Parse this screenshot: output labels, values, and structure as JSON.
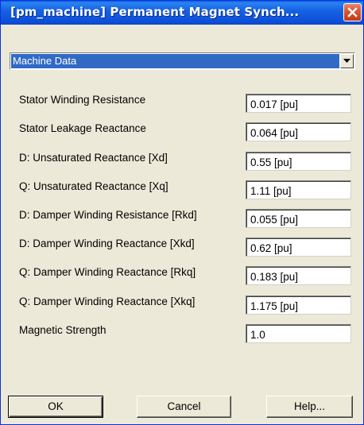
{
  "window": {
    "title": "[pm_machine] Permanent Magnet Synch..."
  },
  "icons": {
    "close": "close-icon",
    "dropdown_arrow": "chevron-down-icon"
  },
  "colors": {
    "titlebar": "#0d4fd8",
    "close_button": "#d9542f",
    "selection": "#316ac5",
    "dialog_background": "#ece9d8"
  },
  "category": {
    "selected": "Machine Data"
  },
  "parameters": [
    {
      "label": "Stator Winding Resistance",
      "value": "0.017 [pu]"
    },
    {
      "label": "Stator Leakage Reactance",
      "value": "0.064 [pu]"
    },
    {
      "label": "D: Unsaturated Reactance [Xd]",
      "value": "0.55 [pu]"
    },
    {
      "label": "Q: Unsaturated Reactance [Xq]",
      "value": "1.11 [pu]"
    },
    {
      "label": "D: Damper Winding Resistance [Rkd]",
      "value": "0.055 [pu]"
    },
    {
      "label": "D: Damper Winding Reactance [Xkd]",
      "value": "0.62 [pu]"
    },
    {
      "label": "Q: Damper Winding Reactance [Rkq]",
      "value": "0.183 [pu]"
    },
    {
      "label": "Q: Damper Winding Reactance [Xkq]",
      "value": "1.175 [pu]"
    },
    {
      "label": "Magnetic Strength",
      "value": "1.0"
    }
  ],
  "buttons": {
    "ok": "OK",
    "cancel": "Cancel",
    "help": "Help..."
  }
}
